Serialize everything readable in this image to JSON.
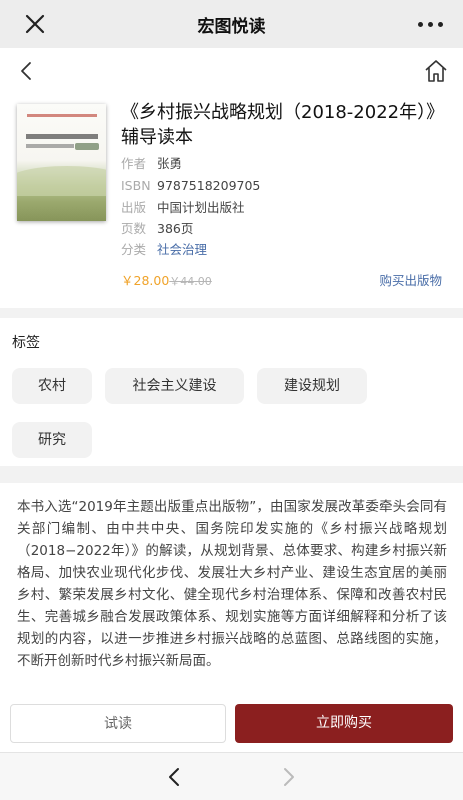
{
  "topbar": {
    "title": "宏图悦读",
    "close_icon": "close-icon",
    "more_icon": "more-dots-icon"
  },
  "nav": {
    "back_icon": "chevron-left-icon",
    "home_icon": "home-icon"
  },
  "book": {
    "title": "《乡村振兴战略规划（2018-2022年）》辅导读本",
    "meta": [
      {
        "key": "作者",
        "value": "张勇"
      },
      {
        "key": "ISBN",
        "value": "9787518209705"
      },
      {
        "key": "出版",
        "value": "中国计划出版社"
      },
      {
        "key": "页数",
        "value": "386页"
      },
      {
        "key": "分类",
        "value": "社会治理"
      }
    ],
    "price": "￥28.00",
    "original_price": "￥44.00",
    "buy_physical_label": "购买出版物"
  },
  "tags": {
    "header": "标签",
    "items": [
      "农村",
      "社会主义建设",
      "建设规划",
      "研究"
    ]
  },
  "description": "本书入选“2019年主题出版重点出版物”，由国家发展改革委牵头会同有关部门编制、由中共中央、国务院印发实施的《乡村振兴战略规划（2018−2022年）》的解读，从规划背景、总体要求、构建乡村振兴新格局、加快农业现代化步伐、发展壮大乡村产业、建设生态宜居的美丽乡村、繁荣发展乡村文化、健全现代乡村治理体系、保障和改善农村民生、完善城乡融合发展政策体系、规划实施等方面详细解释和分析了该规划的内容，以进一步推进乡村振兴战略的总蓝图、总路线图的实施，不断开创新时代乡村振兴新局面。",
  "actions": {
    "try_read": "试读",
    "buy_now": "立即购买"
  },
  "bottom_nav": {
    "prev_icon": "chevron-left-icon",
    "next_icon": "chevron-right-icon"
  },
  "colors": {
    "accent": "#8b1f1f",
    "price": "#f0a32a",
    "link": "#4a6ea8"
  }
}
